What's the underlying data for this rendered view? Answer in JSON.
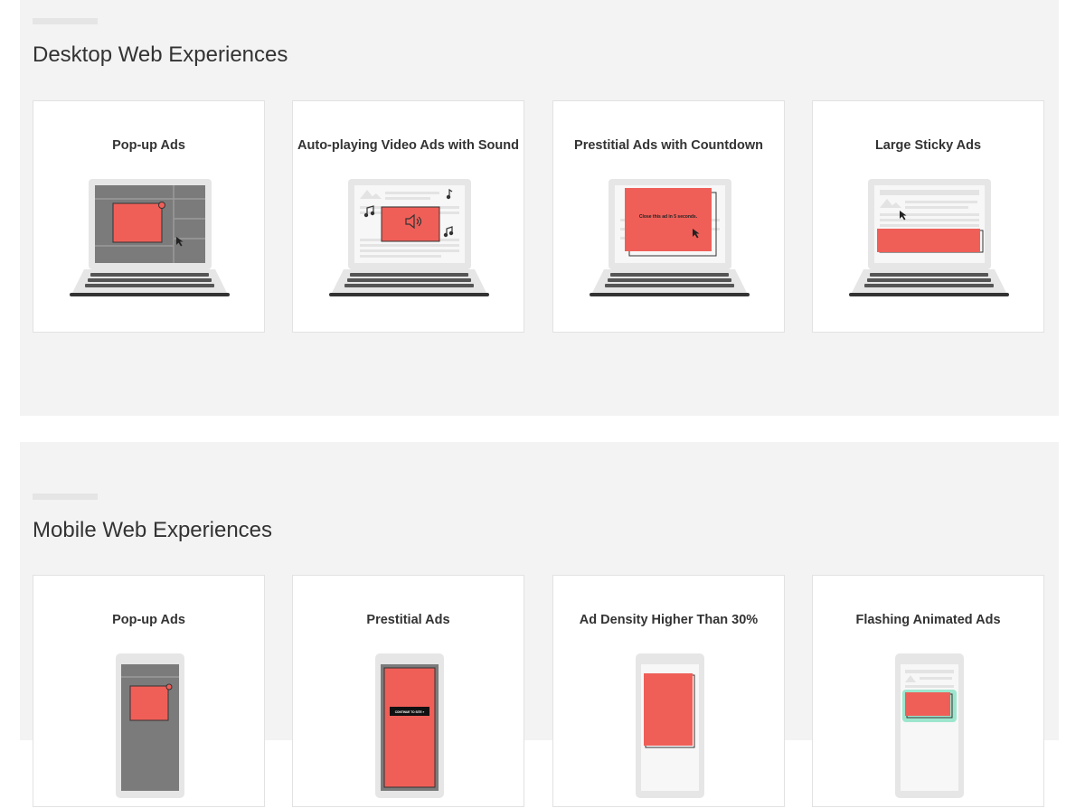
{
  "desktop": {
    "title": "Desktop Web Experiences",
    "cards": [
      {
        "title": "Pop-up Ads",
        "icon": "laptop-popup-ad-illustration"
      },
      {
        "title": "Auto-playing Video Ads with Sound",
        "icon": "laptop-autoplay-video-ad-illustration"
      },
      {
        "title": "Prestitial Ads with Countdown",
        "icon": "laptop-prestitial-countdown-ad-illustration",
        "modal_text": "Close this ad in 5 seconds."
      },
      {
        "title": "Large Sticky Ads",
        "icon": "laptop-large-sticky-ad-illustration"
      }
    ]
  },
  "mobile": {
    "title": "Mobile Web Experiences",
    "cards": [
      {
        "title": "Pop-up Ads",
        "icon": "phone-popup-ad-illustration"
      },
      {
        "title": "Prestitial Ads",
        "icon": "phone-prestitial-ad-illustration",
        "button_text": "CONTINUE TO SITE »"
      },
      {
        "title": "Ad Density Higher Than 30%",
        "icon": "phone-ad-density-illustration"
      },
      {
        "title": "Flashing Animated Ads",
        "icon": "phone-flashing-animated-ad-illustration"
      }
    ]
  },
  "colors": {
    "section_bg": "#f3f3f3",
    "ad_red": "#ef5f58",
    "flash_glow": "#7fe0c0",
    "laptop_gray": "#e6e6e6",
    "keyboard_dark": "#555555"
  }
}
